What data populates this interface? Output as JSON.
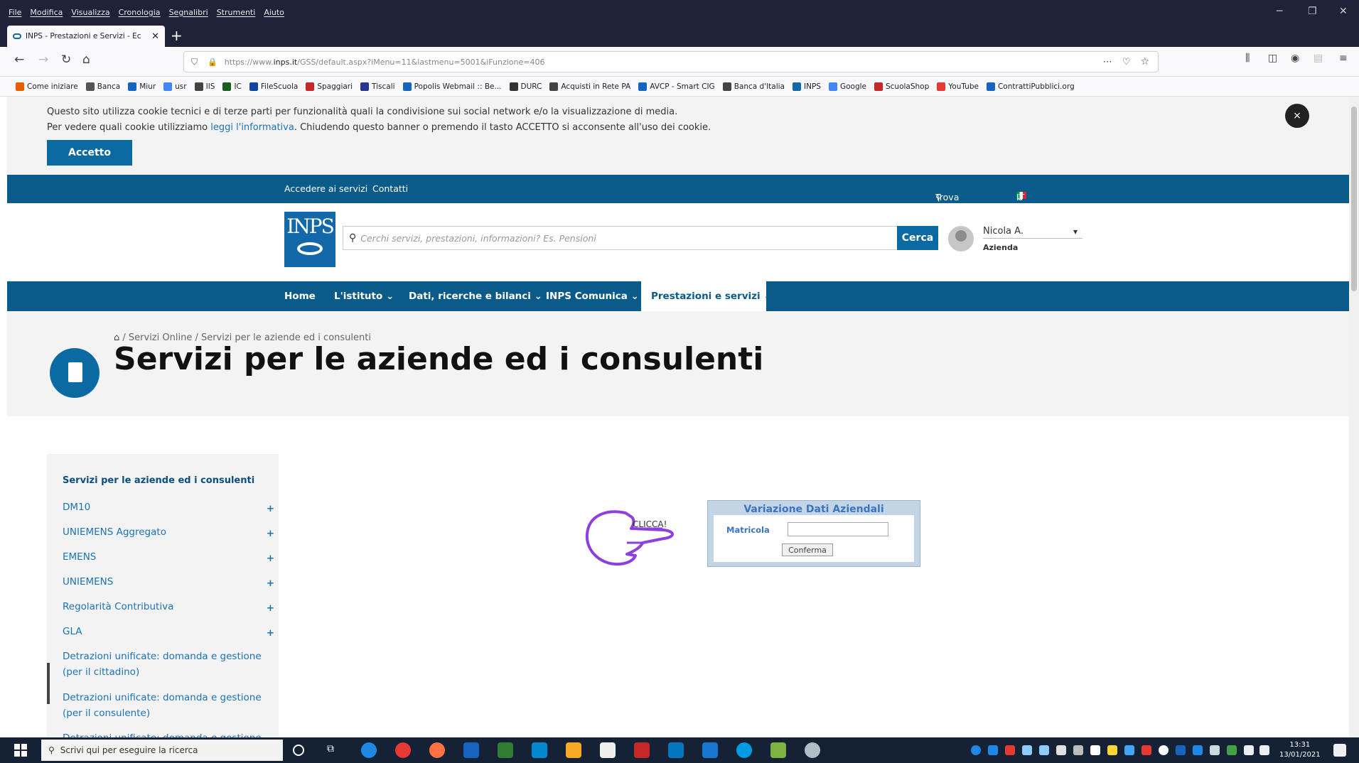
{
  "browser": {
    "menu": [
      "File",
      "Modifica",
      "Visualizza",
      "Cronologia",
      "Segnalibri",
      "Strumenti",
      "Aiuto"
    ],
    "tab_title": "INPS - Prestazioni e Servizi - Ec",
    "url_prefix": "https://www.",
    "url_domain": "inps.it",
    "url_rest": "/GSS/default.aspx?iMenu=11&lastmenu=5001&iFunzione=406",
    "bookmarks": [
      {
        "label": "Come iniziare",
        "icon": "firefox-icon",
        "color": "#e66000"
      },
      {
        "label": "Banca",
        "icon": "question-icon",
        "color": "#555555"
      },
      {
        "label": "Miur",
        "icon": "miur-icon",
        "color": "#1565c0"
      },
      {
        "label": "usr",
        "icon": "google-icon",
        "color": "#4285f4"
      },
      {
        "label": "IIS",
        "icon": "globe-icon",
        "color": "#444444"
      },
      {
        "label": "IC",
        "icon": "book-icon",
        "color": "#1a5e20"
      },
      {
        "label": "FileScuola",
        "icon": "folder-icon",
        "color": "#0d47a1"
      },
      {
        "label": "Spaggiari",
        "icon": "spaggiari-icon",
        "color": "#c62828"
      },
      {
        "label": "Tiscali",
        "icon": "tiscali-icon",
        "color": "#283593"
      },
      {
        "label": "Popolis Webmail :: Be...",
        "icon": "popolis-icon",
        "color": "#1565c0"
      },
      {
        "label": "DURC",
        "icon": "durc-icon",
        "color": "#333333"
      },
      {
        "label": "Acquisti in Rete PA",
        "icon": "globe-icon",
        "color": "#444444"
      },
      {
        "label": "AVCP - Smart CIG",
        "icon": "avcp-icon",
        "color": "#1565c0"
      },
      {
        "label": "Banca d'Italia",
        "icon": "globe-icon",
        "color": "#444444"
      },
      {
        "label": "INPS",
        "icon": "inps-icon",
        "color": "#1268a8"
      },
      {
        "label": "Google",
        "icon": "google-icon",
        "color": "#4285f4"
      },
      {
        "label": "ScuolaShop",
        "icon": "shop-icon",
        "color": "#c62828"
      },
      {
        "label": "YouTube",
        "icon": "youtube-icon",
        "color": "#e53935"
      },
      {
        "label": "ContrattiPubblici.org",
        "icon": "pin-icon",
        "color": "#1565c0"
      }
    ]
  },
  "cookie": {
    "line1": "Questo sito utilizza cookie tecnici e di terze parti per funzionalità quali la condivisione sui social network e/o la visualizzazione di media.",
    "line2_pre": "Per vedere quali cookie utilizziamo ",
    "line2_link": "leggi l'informativa",
    "line2_post": ". Chiudendo questo banner o premendo il tasto ACCETTO si acconsente all'uso dei cookie.",
    "accept_label": "Accetto",
    "close_label": "×"
  },
  "topbar": {
    "accedi": "Accedere ai servizi",
    "contatti": "Contatti",
    "trova": "Trova la sede",
    "lang": "IT"
  },
  "header": {
    "logo_text": "INPS",
    "search_placeholder": "Cerchi servizi, prestazioni, informazioni? Es. Pensioni",
    "search_button": "Cerca",
    "user_name": "Nicola A.",
    "user_role": "Azienda"
  },
  "mainnav": [
    "Home",
    "L'istituto",
    "Dati, ricerche e bilanci",
    "INPS Comunica",
    "Prestazioni e servizi"
  ],
  "hero": {
    "breadcrumb": " / Servizi Online / Servizi per le aziende ed i consulenti",
    "title": "Servizi per le aziende ed i consulenti"
  },
  "sidebar": {
    "title": "Servizi per le aziende ed i consulenti",
    "items": [
      {
        "label": "DM10",
        "plus": "+"
      },
      {
        "label": "UNIEMENS Aggregato",
        "plus": "+"
      },
      {
        "label": "EMENS",
        "plus": "+"
      },
      {
        "label": "UNIEMENS",
        "plus": "+"
      },
      {
        "label": "Regolarità Contributiva",
        "plus": "+"
      },
      {
        "label": "GLA",
        "plus": "+"
      },
      {
        "label": "Detrazioni unificate: domanda e gestione (per il cittadino)",
        "plus": ""
      },
      {
        "label": "Detrazioni unificate: domanda e gestione (per il consulente)",
        "plus": ""
      },
      {
        "label": "Detrazioni unificate: domanda e gestione",
        "plus": ""
      }
    ]
  },
  "form": {
    "title": "Variazione Dati Aziendali",
    "field_label": "Matricola",
    "field_value": "",
    "submit": "Conferma"
  },
  "annotation": {
    "cliccai": "CLICCA!"
  },
  "taskbar": {
    "search_placeholder": "Scrivi qui per eseguire la ricerca",
    "time": "13:31",
    "date": "13/01/2021"
  }
}
